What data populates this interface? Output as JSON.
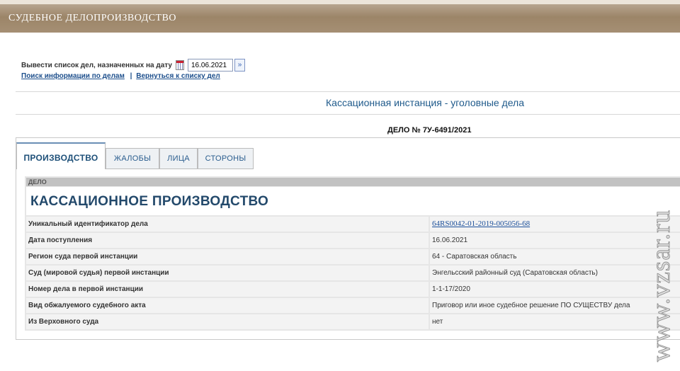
{
  "header": {
    "title": "СУДЕБНОЕ ДЕЛОПРОИЗВОДСТВО"
  },
  "date_filter": {
    "label": "Вывести список дел, назначенных на дату",
    "value": "16.06.2021",
    "go_symbol": "»"
  },
  "links": {
    "search": "Поиск информации по делам",
    "separator": "|",
    "back": "Вернуться к списку дел"
  },
  "instance_title": "Кассационная инстанция - уголовные дела",
  "case_number": "ДЕЛО № 7У-6491/2021",
  "tabs": [
    {
      "label": "ПРОИЗВОДСТВО",
      "active": true
    },
    {
      "label": "ЖАЛОБЫ",
      "active": false
    },
    {
      "label": "ЛИЦА",
      "active": false
    },
    {
      "label": "СТОРОНЫ",
      "active": false
    }
  ],
  "section": {
    "header": "ДЕЛО",
    "title": "КАССАЦИОННОЕ ПРОИЗВОДСТВО",
    "rows": [
      {
        "label": "Уникальный идентификатор дела",
        "value": "64RS0042-01-2019-005056-68",
        "link": true
      },
      {
        "label": "Дата поступления",
        "value": "16.06.2021"
      },
      {
        "label": "Регион суда первой инстанции",
        "value": "64 - Саратовская область"
      },
      {
        "label": "Суд (мировой судья) первой инстанции",
        "value": "Энгельсский районный суд (Саратовская область)"
      },
      {
        "label": "Номер дела в первой инстанции",
        "value": "1-1-17/2020"
      },
      {
        "label": "Вид обжалуемого судебного акта",
        "value": "Приговор или иное судебное решение ПО СУЩЕСТВУ дела"
      },
      {
        "label": "Из Верховного суда",
        "value": "нет"
      }
    ]
  },
  "watermark": {
    "text": "www.vzsar.ru"
  },
  "icons": {
    "calendar": "calendar-icon",
    "go": "double-chevron-right-icon"
  }
}
